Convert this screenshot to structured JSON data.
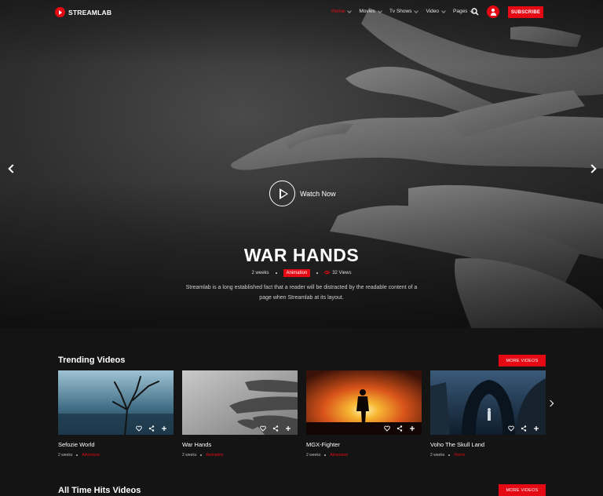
{
  "brand": {
    "name": "STREAMLAB"
  },
  "nav": {
    "items": [
      {
        "label": "Home",
        "active": true
      },
      {
        "label": "Movies"
      },
      {
        "label": "Tv Shows"
      },
      {
        "label": "Video"
      },
      {
        "label": "Pages"
      }
    ],
    "subscribe_label": "SUBSCRIBE"
  },
  "hero": {
    "watch_label": "Watch Now",
    "title": "WAR HANDS",
    "age": "2 weeks",
    "genre": "Animation",
    "views": "32 Views",
    "description": "Streamlab is a long established fact that a reader will be distracted by the readable content of a page when Streamlab at its layout."
  },
  "trending": {
    "title": "Trending Videos",
    "more_label": "MORE VIDEOS",
    "cards": [
      {
        "title": "Sefozie World",
        "age": "2 weeks",
        "genre": "Adventure"
      },
      {
        "title": "War Hands",
        "age": "2 weeks",
        "genre": "Animation"
      },
      {
        "title": "MGX-Fighter",
        "age": "2 weeks",
        "genre": "Adventure"
      },
      {
        "title": "Voho The Skull Land",
        "age": "2 weeks",
        "genre": "Horror"
      }
    ]
  },
  "all_time": {
    "title": "All Time Hits Videos",
    "more_label": "MORE VIDEOS"
  },
  "colors": {
    "accent": "#e50914",
    "background": "#141414"
  }
}
